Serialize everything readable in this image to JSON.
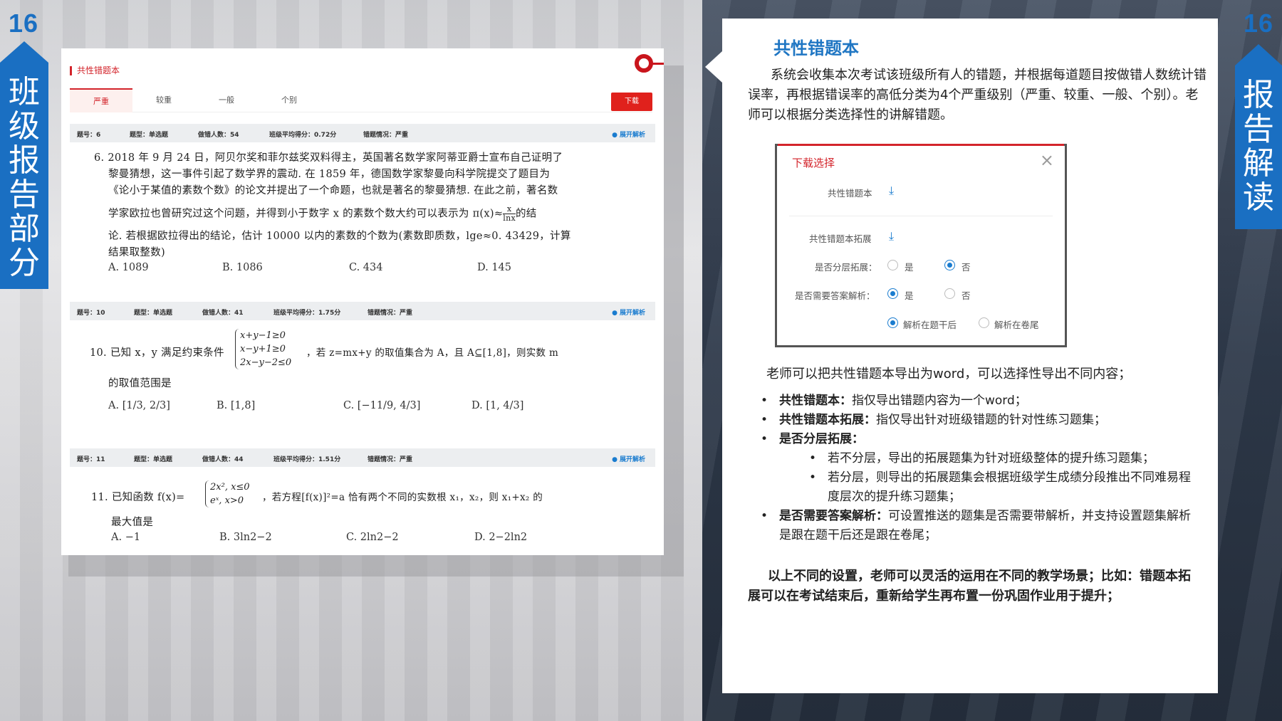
{
  "page_number": "16",
  "left_tab": [
    "班",
    "级",
    "报",
    "告",
    "部",
    "分"
  ],
  "right_tab": [
    "报",
    "告",
    "解",
    "读"
  ],
  "panel": {
    "title": "共性错题本",
    "tabs": [
      "严重",
      "较重",
      "一般",
      "个别"
    ],
    "download_label": "下载",
    "expand_label": "展开解析",
    "questions": [
      {
        "meta": [
          "题号：6",
          "题型：单选题",
          "做错人数：54",
          "班级平均得分：0.72分",
          "错题情况：严重"
        ],
        "lines": [
          "6. 2018 年 9 月 24 日，阿贝尔奖和菲尔兹奖双料得主，英国著名数学家阿蒂亚爵士宣布自己证明了",
          "黎曼猜想，这一事件引起了数学界的震动. 在 1859 年，德国数学家黎曼向科学院提交了题目为",
          "《论小于某值的素数个数》的论文并提出了一个命题，也就是著名的黎曼猜想. 在此之前，著名数",
          "学家欧拉也曾研究过这个问题，并得到小于数字 x 的素数个数大约可以表示为 π(x)≈",
          "论. 若根据欧拉得出的结论，估计 10000 以内的素数的个数为(素数即质数，lge≈0. 43429，计算",
          "结果取整数)"
        ],
        "formula_num": "x",
        "formula_den": "lnx",
        "formula_after": "的结",
        "options": [
          "A. 1089",
          "B. 1086",
          "C. 434",
          "D. 145"
        ]
      },
      {
        "meta": [
          "题号：10",
          "题型：单选题",
          "做错人数：41",
          "班级平均得分：1.75分",
          "错题情况：严重"
        ],
        "stem": "10. 已知 x，y 满足约束条件",
        "brace": [
          "x+y−1≥0",
          "x−y+1≥0",
          "2x−y−2≤0"
        ],
        "stem_after": "，若 z=mx+y 的取值集合为 A，且 A⊆[1,8]，则实数 m",
        "line2": "的取值范围是",
        "options": [
          "A. [1/3, 2/3]",
          "B. [1,8]",
          "C. [−11/9, 4/3]",
          "D. [1, 4/3]"
        ]
      },
      {
        "meta": [
          "题号：11",
          "题型：单选题",
          "做错人数：44",
          "班级平均得分：1.51分",
          "错题情况：严重"
        ],
        "stem": "11. 已知函数 f(x)=",
        "brace": [
          "2x², x≤0",
          "eˣ, x>0"
        ],
        "stem_after": "，若方程[f(x)]²=a 恰有两个不同的实数根 x₁，x₂，则 x₁+x₂ 的",
        "line2": "最大值是",
        "options": [
          "A. −1",
          "B. 3ln2−2",
          "C. 2ln2−2",
          "D. 2−2ln2"
        ]
      }
    ]
  },
  "card": {
    "heading": "共性错题本",
    "intro": "系统会收集本次考试该班级所有人的错题，并根据每道题目按做错人数统计错误率，再根据错误率的高低分类为4个严重级别（严重、较重、一般、个别）。老师可以根据分类选择性的讲解错题。",
    "export_line": "老师可以把共性错题本导出为word，可以选择性导出不同内容；",
    "bullets": [
      {
        "term": "共性错题本：",
        "text": "指仅导出错题内容为一个word；"
      },
      {
        "term": "共性错题本拓展：",
        "text": "指仅导出针对班级错题的针对性练习题集；"
      },
      {
        "term": "是否分层拓展：",
        "text": ""
      },
      {
        "term": "是否需要答案解析：",
        "text": "可设置推送的题集是否需要带解析，并支持设置题集解析是跟在题干后还是跟在卷尾；"
      }
    ],
    "sub_bullets": [
      "若不分层，导出的拓展题集为针对班级整体的提升练习题集；",
      "若分层，则导出的拓展题集会根据班级学生成绩分段推出不同难易程度层次的提升练习题集；"
    ],
    "conclusion": "以上不同的设置，老师可以灵活的运用在不同的教学场景；比如：错题本拓展可以在考试结束后，重新给学生再布置一份巩固作业用于提升；"
  },
  "dialog": {
    "title": "下载选择",
    "close": "×",
    "item1": "共性错题本",
    "item2": "共性错题本拓展",
    "layered_label": "是否分层拓展：",
    "answer_label": "是否需要答案解析：",
    "yes": "是",
    "no": "否",
    "after_stem": "解析在题干后",
    "at_end": "解析在卷尾",
    "layered_selected": "否",
    "answer_selected": "是",
    "position_selected": "解析在题干后"
  },
  "colors": {
    "brand_blue": "#1a6fc2",
    "accent_red": "#d3242b"
  }
}
